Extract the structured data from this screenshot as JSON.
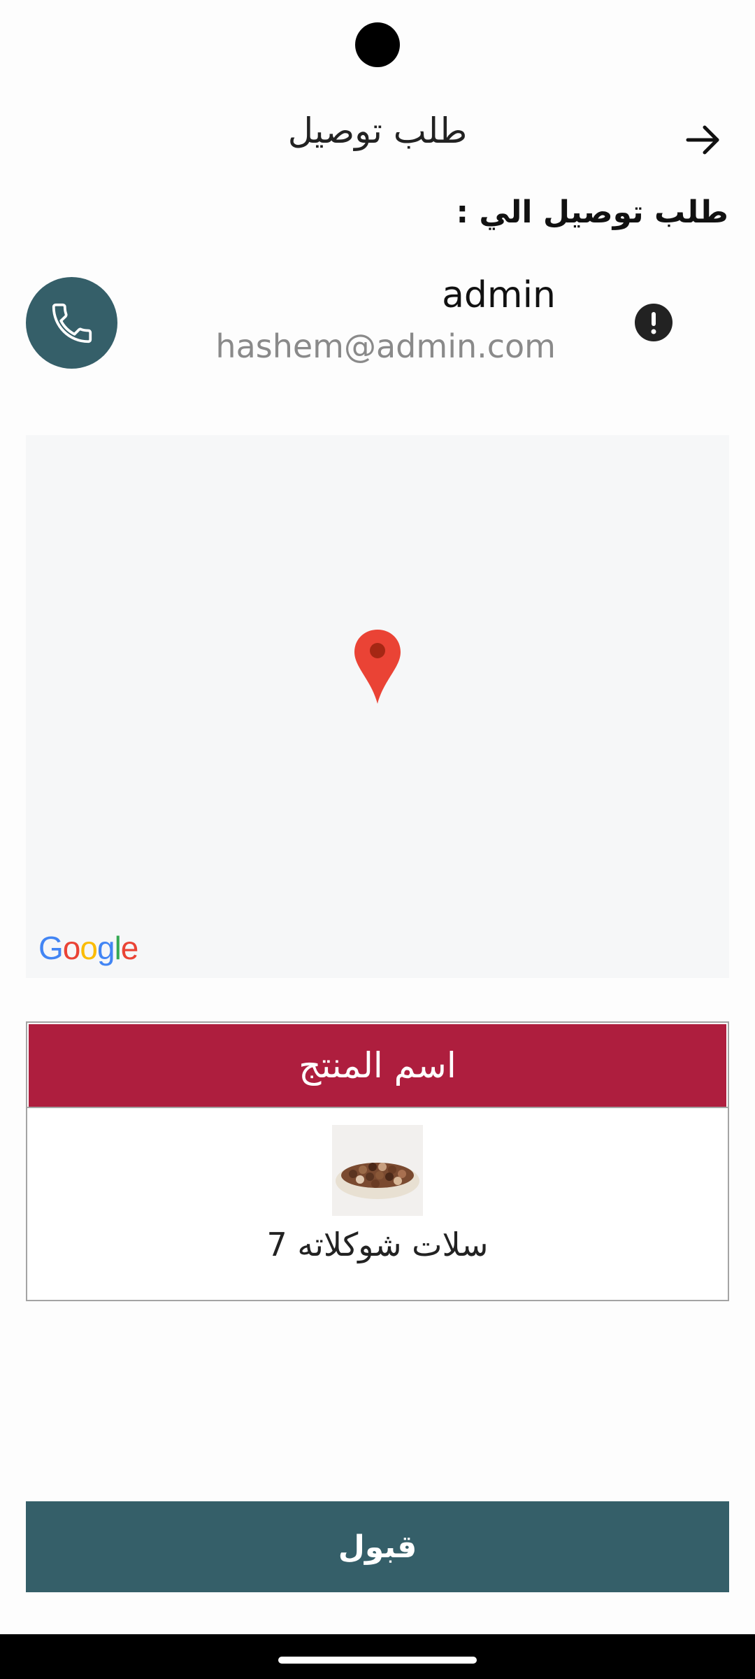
{
  "header": {
    "title": "طلب توصيل",
    "back_icon": "arrow-right-icon"
  },
  "delivery": {
    "section_label": "طلب توصيل الي :"
  },
  "customer": {
    "name": "admin",
    "email": "hashem@admin.com",
    "call_icon": "phone-icon",
    "info_icon": "exclamation-circle-icon"
  },
  "map": {
    "provider_logo": "Google",
    "marker_icon": "map-pin-icon",
    "marker_color": "#ea4335"
  },
  "products": {
    "column_header": "اسم المنتج",
    "items": [
      {
        "name": "سلات شوكلاته 7"
      }
    ]
  },
  "actions": {
    "accept_label": "قبول"
  },
  "colors": {
    "primary": "#355f69",
    "table_header": "#ae1e3e",
    "background": "#fdfdfd"
  }
}
